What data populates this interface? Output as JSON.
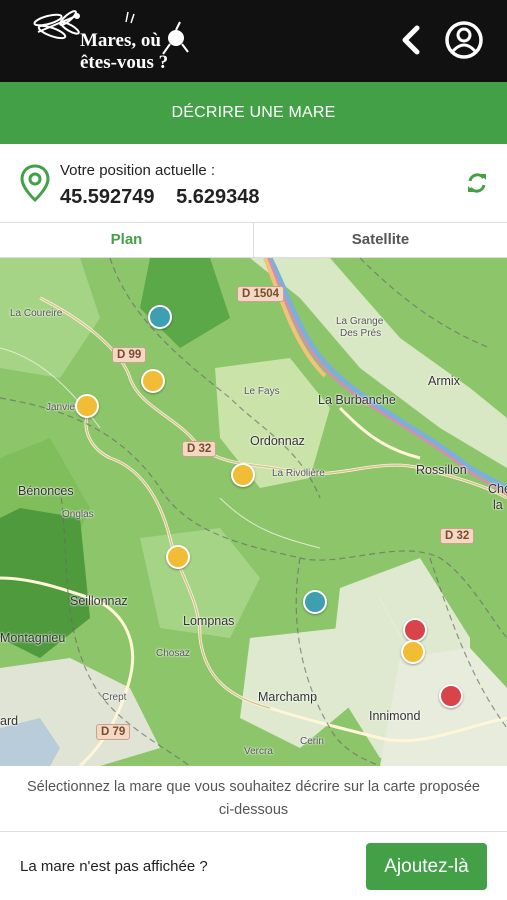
{
  "header": {
    "logo_text_line1": "Mares, où",
    "logo_text_line2": "êtes-vous ?",
    "back_icon": "chevron-left-icon",
    "profile_icon": "user-circle-icon"
  },
  "banner": {
    "title": "DÉCRIRE UNE MARE"
  },
  "position": {
    "label": "Votre position actuelle :",
    "latitude": "45.592749",
    "longitude": "5.629348",
    "pin_icon": "map-pin-icon",
    "refresh_icon": "refresh-icon"
  },
  "tabs": [
    {
      "label": "Plan",
      "active": true
    },
    {
      "label": "Satellite",
      "active": false
    }
  ],
  "map": {
    "places": {
      "la_coureire": "La Coureire",
      "la_grange": "La Grange",
      "des_pres": "Des Prés",
      "armix": "Armix",
      "le_fays": "Le Fays",
      "la_burbanche": "La Burbanche",
      "janvier": "Janvier",
      "ordonnaz": "Ordonnaz",
      "la_rivoliere": "La Rivolière",
      "rossillon": "Rossillon",
      "benonces": "Bénonces",
      "onglas": "Onglas",
      "che": "Che",
      "la": "la",
      "seillonnaz": "Seillonnaz",
      "lompnas": "Lompnas",
      "chosaz": "Chosaz",
      "montagnieu": "Montagnieu",
      "crept": "Crept",
      "marchamp": "Marchamp",
      "innimond": "Innimond",
      "ard": "ard",
      "vercra": "Vercra",
      "cerin": "Cerin"
    },
    "roads": {
      "d1504": "D 1504",
      "d99": "D 99",
      "d32a": "D 32",
      "d32b": "D 32",
      "d79": "D 79"
    },
    "pond_colors": {
      "teal": "#3d9fb0",
      "yellow": "#f2bd36",
      "red": "#d9434a"
    }
  },
  "hint": {
    "text": "Sélectionnez la mare que vous souhaitez décrire sur la carte proposée ci-dessous"
  },
  "footer": {
    "missing_label": "La mare n'est pas affichée ?",
    "add_button": "Ajoutez-là"
  },
  "colors": {
    "accent": "#43a047",
    "topbar": "#111111"
  }
}
